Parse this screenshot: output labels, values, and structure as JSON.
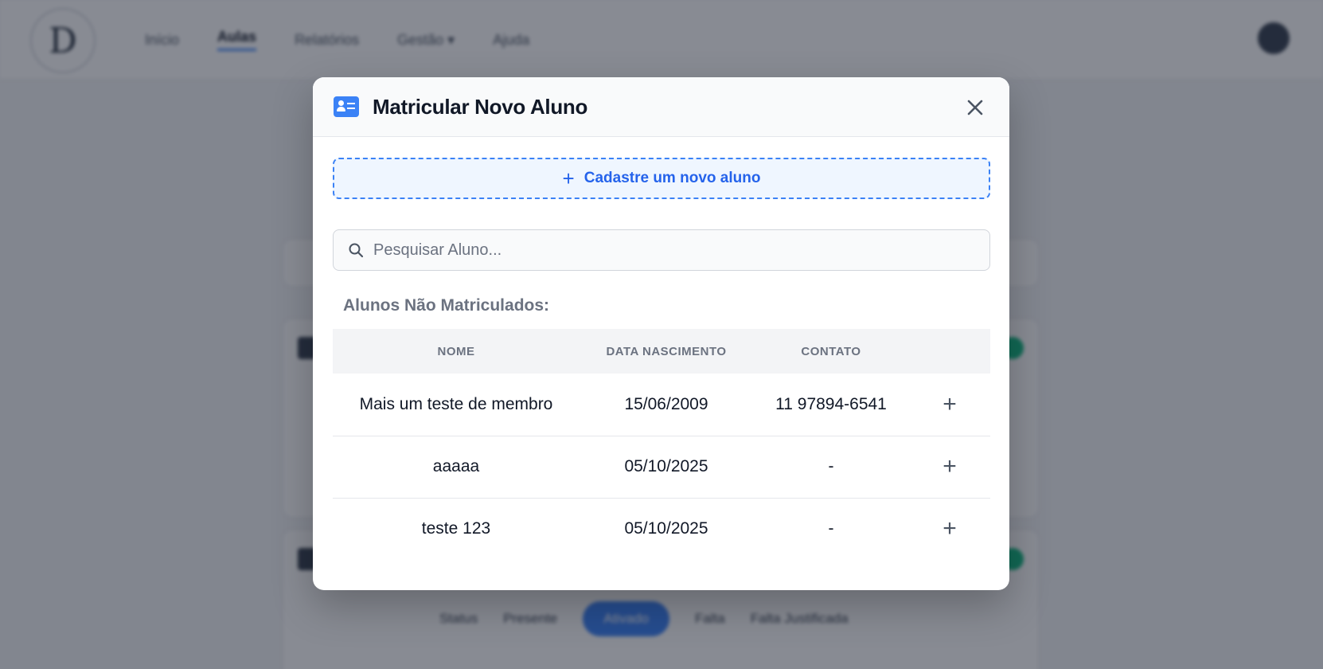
{
  "nav": {
    "logo": "D",
    "items": [
      {
        "label": "Início"
      },
      {
        "label": "Aulas",
        "active": true
      },
      {
        "label": "Relatórios"
      },
      {
        "label": "Gestão ▾"
      },
      {
        "label": "Ajuda"
      }
    ]
  },
  "background_status": [
    "Status",
    "Presente",
    "Ativado",
    "Falta",
    "Falta Justificada"
  ],
  "modal": {
    "title": "Matricular Novo Aluno",
    "header_icon": "id-card-icon",
    "close_icon": "close-icon",
    "add_button_label": "Cadastre um novo aluno",
    "search_placeholder": "Pesquisar Aluno...",
    "section_label": "Alunos Não Matriculados:",
    "table": {
      "headers": {
        "name": "NOME",
        "birth": "DATA NASCIMENTO",
        "contact": "CONTATO"
      },
      "rows": [
        {
          "name": "Mais um teste de membro",
          "birth": "15/06/2009",
          "contact": "11 97894-6541",
          "action": "+"
        },
        {
          "name": "aaaaa",
          "birth": "05/10/2025",
          "contact": "-",
          "action": "+"
        },
        {
          "name": "teste 123",
          "birth": "05/10/2025",
          "contact": "-",
          "action": "+"
        }
      ]
    }
  },
  "colors": {
    "accent": "#3b82f6",
    "accent_text": "#2563eb",
    "overlay": "#111827",
    "success": "#10b981"
  }
}
